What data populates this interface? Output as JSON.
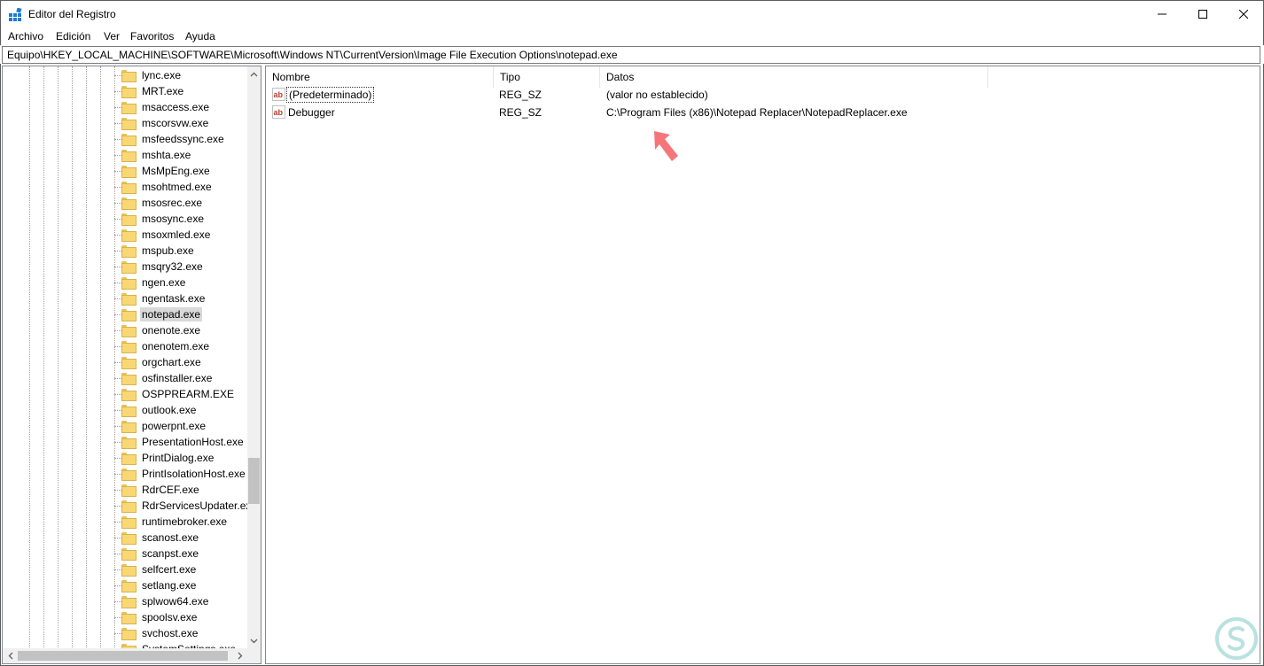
{
  "window": {
    "title": "Editor del Registro",
    "icon": "regedit-icon"
  },
  "menu": {
    "items": [
      "Archivo",
      "Edición",
      "Ver",
      "Favoritos",
      "Ayuda"
    ]
  },
  "address": {
    "path": "Equipo\\HKEY_LOCAL_MACHINE\\SOFTWARE\\Microsoft\\Windows NT\\CurrentVersion\\Image File Execution Options\\notepad.exe"
  },
  "tree": {
    "items": [
      "lync.exe",
      "MRT.exe",
      "msaccess.exe",
      "mscorsvw.exe",
      "msfeedssync.exe",
      "mshta.exe",
      "MsMpEng.exe",
      "msohtmed.exe",
      "msosrec.exe",
      "msosync.exe",
      "msoxmled.exe",
      "mspub.exe",
      "msqry32.exe",
      "ngen.exe",
      "ngentask.exe",
      "notepad.exe",
      "onenote.exe",
      "onenotem.exe",
      "orgchart.exe",
      "osfinstaller.exe",
      "OSPPREARM.EXE",
      "outlook.exe",
      "powerpnt.exe",
      "PresentationHost.exe",
      "PrintDialog.exe",
      "PrintIsolationHost.exe",
      "RdrCEF.exe",
      "RdrServicesUpdater.exe",
      "runtimebroker.exe",
      "scanost.exe",
      "scanpst.exe",
      "selfcert.exe",
      "setlang.exe",
      "splwow64.exe",
      "spoolsv.exe",
      "svchost.exe",
      "SystemSettings.exe"
    ],
    "selected": "notepad.exe"
  },
  "list": {
    "columns": {
      "name": "Nombre",
      "type": "Tipo",
      "data": "Datos"
    },
    "rows": [
      {
        "name": "(Predeterminado)",
        "type": "REG_SZ",
        "data": "(valor no establecido)",
        "icon": "string-value-icon"
      },
      {
        "name": "Debugger",
        "type": "REG_SZ",
        "data": "C:\\Program Files (x86)\\Notepad Replacer\\NotepadReplacer.exe",
        "icon": "string-value-icon"
      }
    ]
  },
  "colors": {
    "accent_arrow": "#f4767a",
    "folder": "#f8d775",
    "selection": "#d9d9d9",
    "watermark": "#b8e2df"
  }
}
